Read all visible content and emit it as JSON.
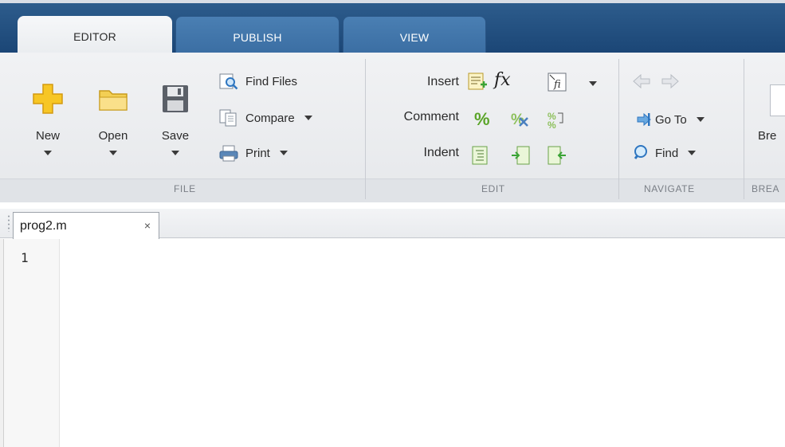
{
  "tabs": [
    {
      "label": "EDITOR",
      "active": true
    },
    {
      "label": "PUBLISH",
      "active": false
    },
    {
      "label": "VIEW",
      "active": false
    }
  ],
  "file_group": {
    "label": "FILE",
    "new_label": "New",
    "open_label": "Open",
    "save_label": "Save",
    "find_files_label": "Find Files",
    "compare_label": "Compare",
    "print_label": "Print"
  },
  "edit_group": {
    "label": "EDIT",
    "insert_label": "Insert",
    "comment_label": "Comment",
    "indent_label": "Indent",
    "fx_label": "fx"
  },
  "navigate_group": {
    "label": "NAVIGATE",
    "goto_label": "Go To",
    "find_label": "Find"
  },
  "breakpoints_group": {
    "label": "BREA",
    "button_label": "Bre"
  },
  "document": {
    "tab_name": "prog2.m",
    "close_glyph": "×",
    "line_numbers": [
      "1"
    ]
  },
  "colors": {
    "tabbar": "#1b4676",
    "ribbon": "#eceef1",
    "icon_yellow": "#f5c518",
    "icon_green": "#3aa335"
  }
}
